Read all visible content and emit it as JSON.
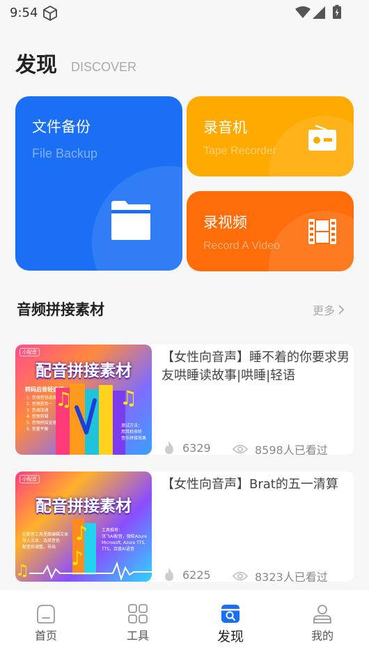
{
  "status_bar": {
    "time": "9:54"
  },
  "header": {
    "title": "发现",
    "subtitle": "DISCOVER"
  },
  "cards": [
    {
      "title": "文件备份",
      "subtitle": "File Backup",
      "icon": "folder-icon",
      "color": "#1a6ff4"
    },
    {
      "title": "录音机",
      "subtitle": "Tape Recorder",
      "icon": "radio-icon",
      "color": "#ffaa00"
    },
    {
      "title": "录视频",
      "subtitle": "Record A Video",
      "icon": "film-icon",
      "color": "#ff6c0a"
    }
  ],
  "section": {
    "title": "音频拼接素材",
    "more": "更多"
  },
  "items": [
    {
      "headline": "【女性向音声】睡不着的你要求男友哄睡读故事|哄睡|轻语",
      "hot_count": "6329",
      "view_text": "8598人已看过",
      "thumb": {
        "tag": "小配音",
        "banner": "配音拼接素材",
        "side_title": "转码后音轻选择",
        "side_lines": [
          "1. 音调音轻选择",
          "2. 音频是否一",
          "3. 音调加速",
          "4. 音频剪辑",
          "5. 音频拼接处理",
          "6. 音量平衡"
        ],
        "side_right": "测试方法：\n用耳机收听\n音乐拼接效果"
      }
    },
    {
      "headline": "【女性向音声】Brat的五一清算",
      "hot_count": "6225",
      "view_text": "8323人已看过",
      "thumb": {
        "tag": "小配音",
        "banner": "配音拼接素材",
        "side_left": "在配音工具里面编辑文本\n导入文本：选择音色\n配音后调整，导出",
        "side_right": "工具推荐：\n讯飞AI配音，微软Azure\nMicrosoft, Azure TTS,\nTTS，百度AI语音"
      }
    }
  ],
  "bottom_nav": [
    {
      "label": "首页",
      "icon": "home-icon"
    },
    {
      "label": "工具",
      "icon": "grid-icon"
    },
    {
      "label": "发现",
      "icon": "discover-icon",
      "active": true
    },
    {
      "label": "我的",
      "icon": "person-icon"
    }
  ]
}
